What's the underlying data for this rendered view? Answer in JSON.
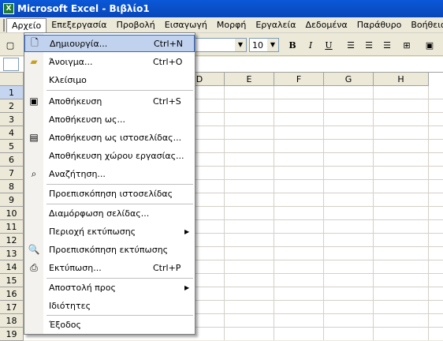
{
  "titlebar": {
    "icon": "excel-icon",
    "title": "Microsoft Excel - Βιβλίο1"
  },
  "menubar": [
    "Αρχείο",
    "Επεξεργασία",
    "Προβολή",
    "Εισαγωγή",
    "Μορφή",
    "Εργαλεία",
    "Δεδομένα",
    "Παράθυρο",
    "Βοήθεια"
  ],
  "toolbar": {
    "font_size": "10",
    "bold": "B",
    "italic": "I",
    "underline": "U"
  },
  "columns": [
    "D",
    "E",
    "F",
    "G",
    "H"
  ],
  "rows": [
    "1",
    "2",
    "3",
    "4",
    "5",
    "6",
    "7",
    "8",
    "9",
    "10",
    "11",
    "12",
    "13",
    "14",
    "15",
    "16",
    "17",
    "18",
    "19"
  ],
  "file_menu": {
    "items": [
      {
        "label": "Δημιουργία...",
        "shortcut": "Ctrl+N",
        "icon": "new-document-icon"
      },
      {
        "label": "Άνοιγμα...",
        "shortcut": "Ctrl+O",
        "icon": "open-folder-icon"
      },
      {
        "label": "Κλείσιμο",
        "shortcut": "",
        "icon": ""
      },
      {
        "label": "Αποθήκευση",
        "shortcut": "Ctrl+S",
        "icon": "save-icon"
      },
      {
        "label": "Αποθήκευση ως...",
        "shortcut": "",
        "icon": ""
      },
      {
        "label": "Αποθήκευση ως ιστοσελίδας...",
        "shortcut": "",
        "icon": "save-web-icon"
      },
      {
        "label": "Αποθήκευση χώρου εργασίας...",
        "shortcut": "",
        "icon": ""
      },
      {
        "label": "Αναζήτηση...",
        "shortcut": "",
        "icon": "search-icon"
      },
      {
        "label": "Προεπισκόπηση ιστοσελίδας",
        "shortcut": "",
        "icon": ""
      },
      {
        "label": "Διαμόρφωση σελίδας...",
        "shortcut": "",
        "icon": ""
      },
      {
        "label": "Περιοχή εκτύπωσης",
        "shortcut": "",
        "icon": ""
      },
      {
        "label": "Προεπισκόπηση εκτύπωσης",
        "shortcut": "",
        "icon": "print-preview-icon"
      },
      {
        "label": "Εκτύπωση...",
        "shortcut": "Ctrl+P",
        "icon": "printer-icon"
      },
      {
        "label": "Αποστολή προς",
        "shortcut": "",
        "icon": ""
      },
      {
        "label": "Ιδιότητες",
        "shortcut": "",
        "icon": ""
      },
      {
        "label": "Έξοδος",
        "shortcut": "",
        "icon": ""
      }
    ]
  }
}
